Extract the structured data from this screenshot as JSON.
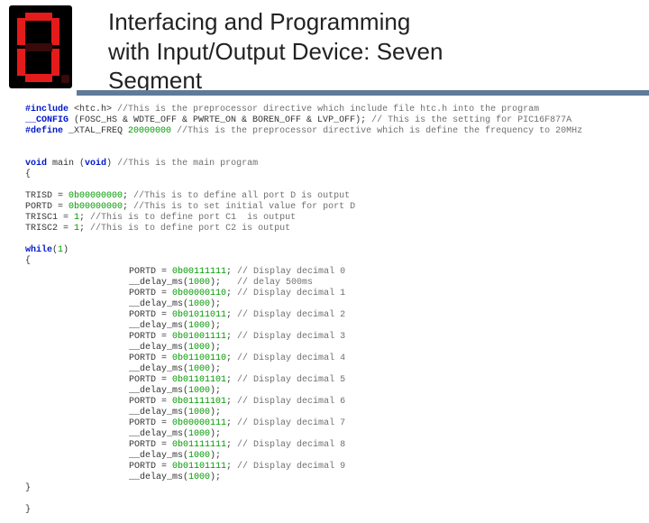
{
  "title_l1": "Interfacing and Programming",
  "title_l2": "with Input/Output Device: Seven",
  "title_l3": "Segment",
  "pre_lines": [
    {
      "k": "#include",
      "t": " <htc.h> ",
      "c": "//This is the preprocessor directive which include file htc.h into the program"
    },
    {
      "k": "__CONFIG",
      "t": " (FOSC_HS & WDTE_OFF & PWRTE_ON & BOREN_OFF & LVP_OFF); ",
      "c": "// This is the setting for PIC16F877A"
    },
    {
      "k": "#define",
      "t": " _XTAL_FREQ ",
      "n": "20000000 ",
      "c": "//This is the preprocessor directive which is define the frequency to 20MHz"
    }
  ],
  "main_decl": {
    "pre": "void",
    "mid": " main (",
    "post": "void",
    "end": ") ",
    "c": "//This is the main program"
  },
  "setup": [
    {
      "l": "TRISD = ",
      "v": "0b00000000",
      "s": "; ",
      "c": "//This is to define all port D is output"
    },
    {
      "l": "PORTD = ",
      "v": "0b00000000",
      "s": "; ",
      "c": "//This is to set initial value for port D"
    },
    {
      "l": "TRISC1 = ",
      "v": "1",
      "s": "; ",
      "c": "//This is to define port C1  is output"
    },
    {
      "l": "TRISC2 = ",
      "v": "1",
      "s": "; ",
      "c": "//This is to define port C2 is output"
    }
  ],
  "while_kw": "while",
  "while_arg": "1",
  "loop": [
    {
      "l": "PORTD = ",
      "v": "0b00111111",
      "c": "// Display decimal 0"
    },
    {
      "l": "__delay_ms(",
      "v": "1000",
      "c": "// delay 500ms",
      "close": ");"
    },
    {
      "l": "PORTD = ",
      "v": "0b00000110",
      "c": "// Display decimal 1"
    },
    {
      "l": "__delay_ms(",
      "v": "1000",
      "c": "",
      "close": ");"
    },
    {
      "l": "PORTD = ",
      "v": "0b01011011",
      "c": "// Display decimal 2"
    },
    {
      "l": "__delay_ms(",
      "v": "1000",
      "c": "",
      "close": ");"
    },
    {
      "l": "PORTD = ",
      "v": "0b01001111",
      "c": "// Display decimal 3"
    },
    {
      "l": "__delay_ms(",
      "v": "1000",
      "c": "",
      "close": ");"
    },
    {
      "l": "PORTD = ",
      "v": "0b01100110",
      "c": "// Display decimal 4"
    },
    {
      "l": "__delay_ms(",
      "v": "1000",
      "c": "",
      "close": ");"
    },
    {
      "l": "PORTD = ",
      "v": "0b01101101",
      "c": "// Display decimal 5"
    },
    {
      "l": "__delay_ms(",
      "v": "1000",
      "c": "",
      "close": ");"
    },
    {
      "l": "PORTD = ",
      "v": "0b01111101",
      "c": "// Display decimal 6"
    },
    {
      "l": "__delay_ms(",
      "v": "1000",
      "c": "",
      "close": ");"
    },
    {
      "l": "PORTD = ",
      "v": "0b00000111",
      "c": "// Display decimal 7"
    },
    {
      "l": "__delay_ms(",
      "v": "1000",
      "c": "",
      "close": ");"
    },
    {
      "l": "PORTD = ",
      "v": "0b01111111",
      "c": "// Display decimal 8"
    },
    {
      "l": "__delay_ms(",
      "v": "1000",
      "c": "",
      "close": ");"
    },
    {
      "l": "PORTD = ",
      "v": "0b01101111",
      "c": "// Display decimal 9"
    },
    {
      "l": "__delay_ms(",
      "v": "1000",
      "c": "",
      "close": ");"
    }
  ]
}
